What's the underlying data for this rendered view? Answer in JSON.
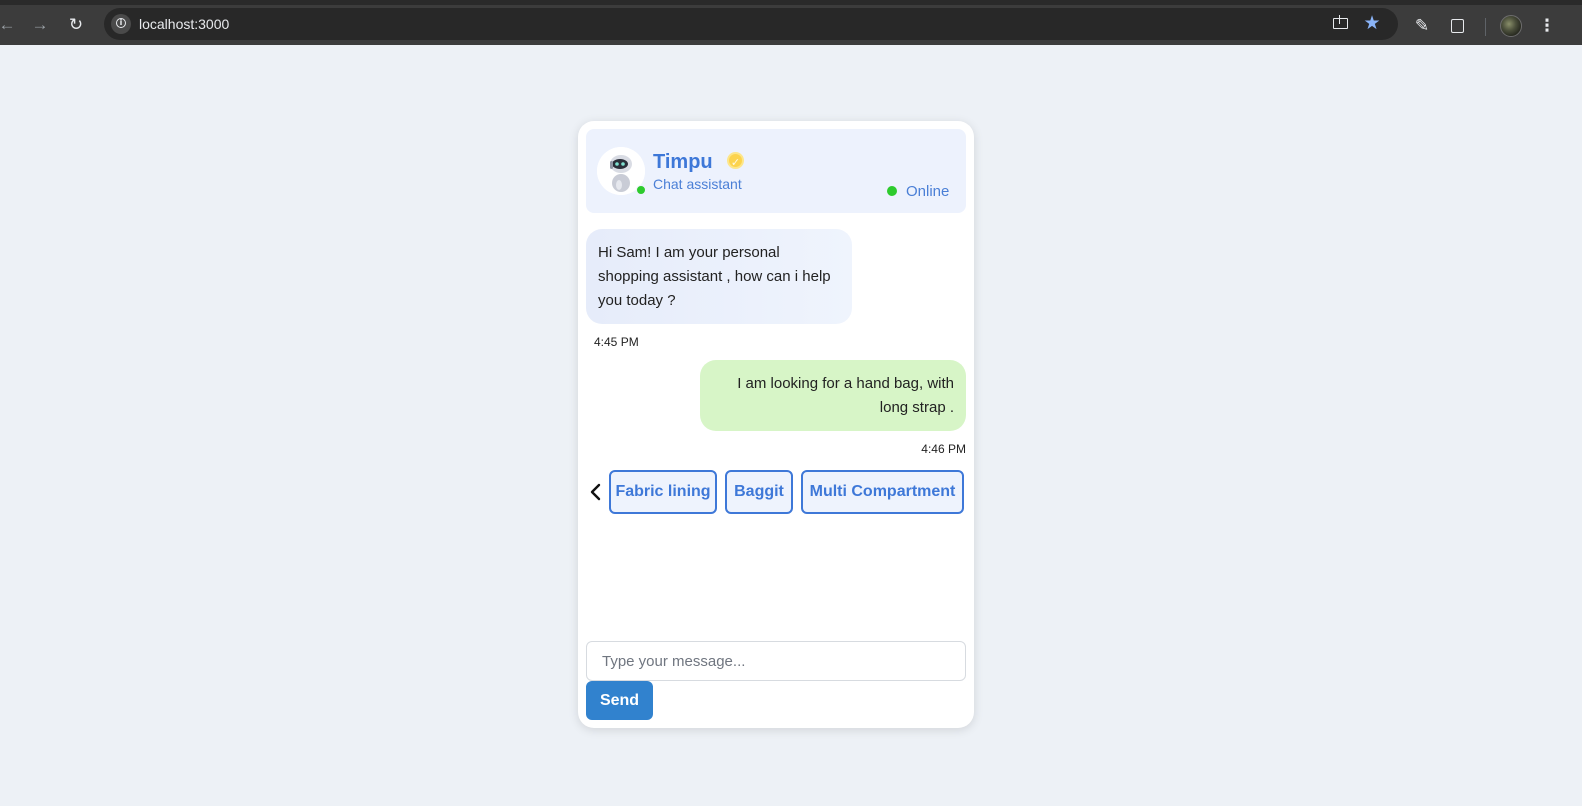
{
  "browser": {
    "url": "localhost:3000",
    "icons": [
      "back-arrow-icon",
      "forward-arrow-icon",
      "reload-icon",
      "site-info-icon",
      "install-app-icon",
      "bookmark-star-icon",
      "eyedropper-icon",
      "extensions-icon",
      "profile-avatar",
      "kebab-menu-icon"
    ]
  },
  "chat": {
    "header": {
      "name": "Timpu",
      "subtitle": "Chat assistant",
      "status": "Online",
      "verified_icon": "✓"
    },
    "messages": [
      {
        "sender": "bot",
        "text": "Hi Sam! I am your personal shopping assistant , how can i help you today ?",
        "time": "4:45 PM"
      },
      {
        "sender": "user",
        "text": "I am looking for a hand bag, with long strap .",
        "time": "4:46 PM"
      }
    ],
    "suggestions": [
      "Fabric lining",
      "Baggit",
      "Multi Compartment"
    ],
    "input": {
      "placeholder": "Type your message...",
      "value": ""
    },
    "send_label": "Send"
  },
  "colors": {
    "accent": "#3e78d8",
    "send_button": "#3182ce",
    "online": "#2dcb2d",
    "user_bubble": "#d7f5c7",
    "bot_bubble": "#e6ecfa",
    "page_bg": "#edf1f6"
  }
}
